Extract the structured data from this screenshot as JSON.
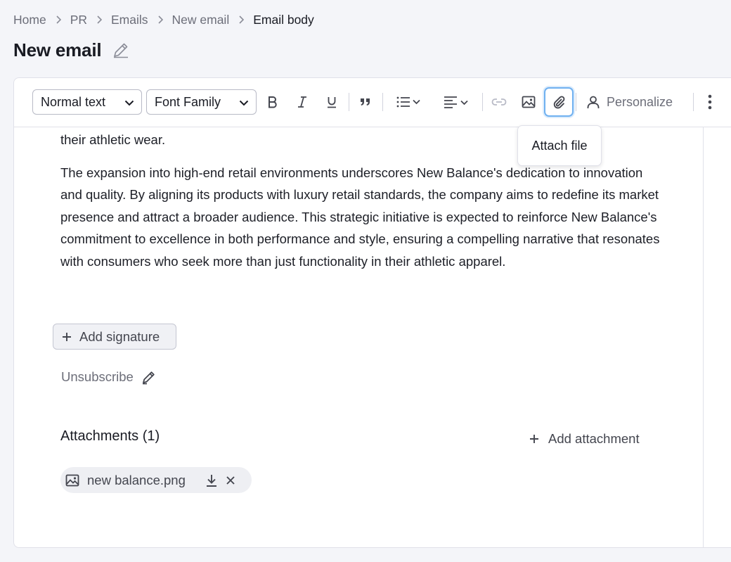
{
  "breadcrumb": {
    "items": [
      "Home",
      "PR",
      "Emails",
      "New email"
    ],
    "current": "Email body"
  },
  "page": {
    "title": "New email"
  },
  "toolbar": {
    "text_style": "Normal text",
    "font_family": "Font Family",
    "personalize_label": "Personalize",
    "attach_tooltip": "Attach file"
  },
  "email_body": {
    "partial_line": "their athletic wear.",
    "paragraph": "The expansion into high-end retail environments underscores New Balance's dedication to innovation and quality. By aligning its products with luxury retail standards, the company aims to redefine its market presence and attract a broader audience. This strategic initiative is expected to reinforce New Balance's commitment to excellence in both performance and style, ensuring a compelling narrative that resonates with consumers who seek more than just functionality in their athletic apparel."
  },
  "signature": {
    "add_label": "Add signature"
  },
  "unsubscribe": {
    "label": "Unsubscribe"
  },
  "attachments": {
    "title": "Attachments (1)",
    "add_label": "Add attachment",
    "files": [
      {
        "name": "new balance.png"
      }
    ]
  },
  "colors": {
    "accent_focus": "#6fb0f0",
    "text_primary": "#191b23",
    "text_secondary": "#6c6e79",
    "border": "#e0e1e9"
  }
}
